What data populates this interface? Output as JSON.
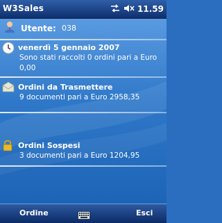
{
  "titlebar": {
    "title": "W3Sales",
    "time": "11.59",
    "icons": [
      "connectivity-arrows-icon",
      "speaker-muted-icon"
    ]
  },
  "user": {
    "label": "Utente:",
    "id": "038",
    "icon": "user-icon"
  },
  "date": {
    "heading": "venerdì 5 gennaio 2007",
    "line1": "Sono stati raccolti 0 ordini pari a Euro",
    "line2": "0,00",
    "icon": "clock-icon"
  },
  "to_send": {
    "heading": "Ordini da Trasmettere",
    "text": "9 documenti pari a Euro 2958,35",
    "icon": "envelope-icon"
  },
  "suspended": {
    "heading": "Ordini Sospesi",
    "text": "3 documenti pari a Euro 1204,95",
    "icon": "lock-icon"
  },
  "softkeys": {
    "left": "Ordine",
    "right": "Esci",
    "center_icon": "keyboard-icon"
  },
  "colors": {
    "titlebar": "#0f2f6d",
    "background": "#2f78c9"
  }
}
